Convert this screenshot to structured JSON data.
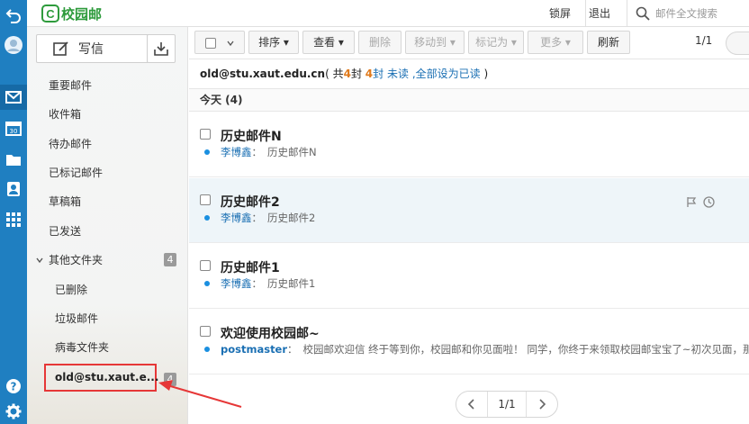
{
  "app": {
    "logo_text": "校园邮",
    "logo_mark": "C"
  },
  "topbar": {
    "lock_label": "锁屏",
    "logout_label": "退出",
    "search_placeholder": "邮件全文搜索"
  },
  "sidebar": {
    "compose_label": "写信",
    "items": [
      {
        "label": "重要邮件"
      },
      {
        "label": "收件箱"
      },
      {
        "label": "待办邮件"
      },
      {
        "label": "已标记邮件"
      },
      {
        "label": "草稿箱"
      },
      {
        "label": "已发送"
      },
      {
        "label": "其他文件夹",
        "badge": "4"
      },
      {
        "label": "已删除"
      },
      {
        "label": "垃圾邮件"
      },
      {
        "label": "病毒文件夹"
      }
    ],
    "account_folder": {
      "label": "old@stu.xaut.e...",
      "badge": "4"
    }
  },
  "toolbar": {
    "sort_label": "排序",
    "view_label": "查看",
    "delete_label": "删除",
    "move_label": "移动到",
    "mark_label": "标记为",
    "more_label": "更多",
    "refresh_label": "刷新",
    "page_indicator": "1/1"
  },
  "summary": {
    "account": "old@stu.xaut.edu.cn",
    "prefix": "( 共",
    "total": "4",
    "mid": "封",
    "unread_count": "4",
    "unread_suffix": "封 未读",
    "mark_all_read": ",全部设为已读",
    "suffix": " )"
  },
  "day_group": {
    "label": "今天 (4)"
  },
  "emails": [
    {
      "subject": "历史邮件N",
      "sender": "李博鑫",
      "preview": "历史邮件N"
    },
    {
      "subject": "历史邮件2",
      "sender": "李博鑫",
      "preview": "历史邮件2"
    },
    {
      "subject": "历史邮件1",
      "sender": "李博鑫",
      "preview": "历史邮件1"
    },
    {
      "subject": "欢迎使用校园邮~",
      "sender": "postmaster",
      "preview": "校园邮欢迎信 终于等到你，校园邮和你见面啦！ 同学，你终于来领取校园邮宝宝了~初次见面，那我们一起"
    }
  ],
  "pagination": {
    "current": "1/1"
  },
  "colors": {
    "rail": "#1f7fc1",
    "brand": "#2e9b3c",
    "highlight": "#e63737",
    "unread": "#e07a1b",
    "link": "#1a6fb3"
  }
}
